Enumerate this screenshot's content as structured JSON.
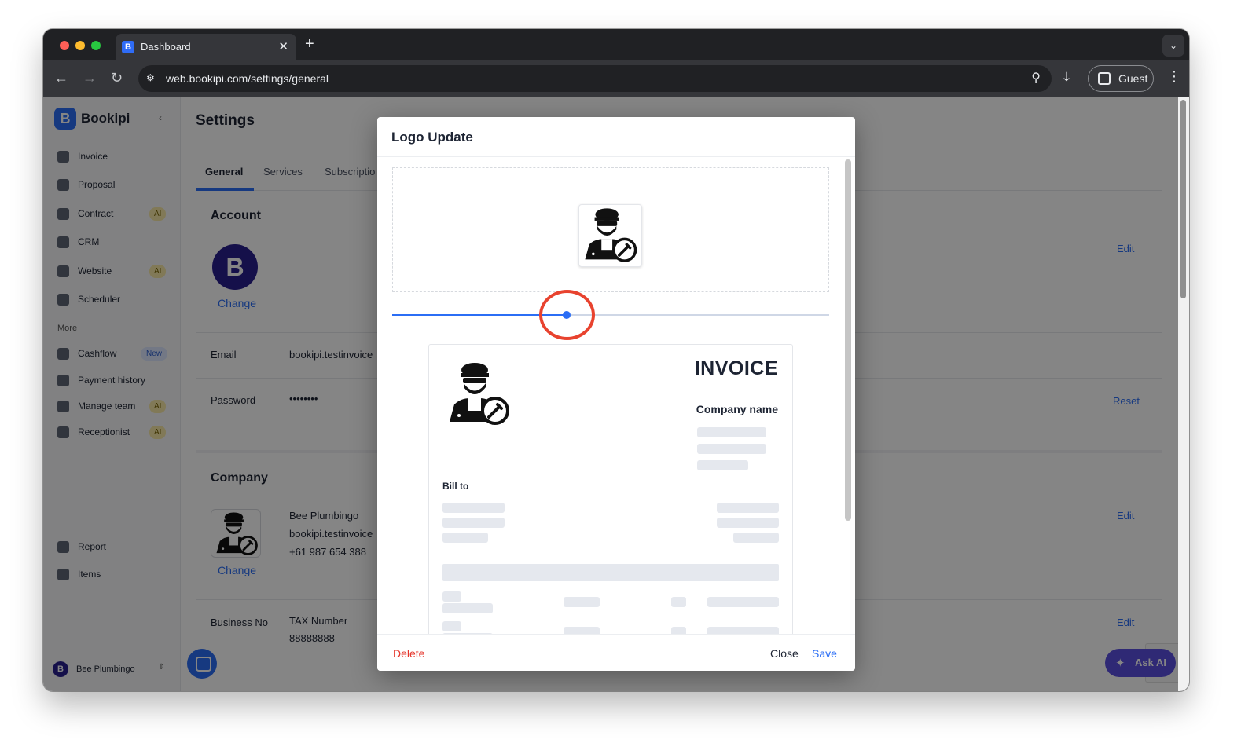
{
  "browser": {
    "tab_title": "Dashboard",
    "tab_favicon_letter": "B",
    "url": "web.bookipi.com/settings/general",
    "profile_label": "Guest"
  },
  "sidebar": {
    "brand": "Bookipi",
    "items": [
      {
        "label": "Invoice",
        "icon": "invoice-icon"
      },
      {
        "label": "Proposal",
        "icon": "proposal-icon"
      },
      {
        "label": "Contract",
        "icon": "contract-icon",
        "badge": "AI"
      },
      {
        "label": "CRM",
        "icon": "crm-icon"
      },
      {
        "label": "Website",
        "icon": "website-icon",
        "badge": "AI"
      },
      {
        "label": "Scheduler",
        "icon": "scheduler-icon"
      }
    ],
    "more_label": "More",
    "more_items": [
      {
        "label": "Cashflow",
        "icon": "cashflow-icon",
        "badge": "New"
      },
      {
        "label": "Payment history",
        "icon": "payment-history-icon"
      },
      {
        "label": "Manage team",
        "icon": "team-icon",
        "badge": "AI"
      },
      {
        "label": "Receptionist",
        "icon": "headset-icon",
        "badge": "AI"
      }
    ],
    "bottom_items": [
      {
        "label": "Report",
        "icon": "report-icon"
      },
      {
        "label": "Items",
        "icon": "items-icon"
      }
    ],
    "account_name": "Bee Plumbingo"
  },
  "settings": {
    "title": "Settings",
    "tabs": [
      "General",
      "Services",
      "Subscriptio"
    ],
    "account": {
      "heading": "Account",
      "avatar_letter": "B",
      "change_label": "Change",
      "edit_label": "Edit",
      "email_label": "Email",
      "email_value": "bookipi.testinvoice",
      "password_label": "Password",
      "password_value": "••••••••",
      "reset_label": "Reset"
    },
    "company": {
      "heading": "Company",
      "change_label": "Change",
      "name": "Bee Plumbingo",
      "email": "bookipi.testinvoice",
      "phone": "+61 987 654 388",
      "edit_label": "Edit",
      "business_no_label": "Business No",
      "tax_label": "TAX Number",
      "tax_value": "88888888",
      "business_edit_label": "Edit"
    },
    "ask_ai_label": "Ask AI"
  },
  "modal": {
    "title": "Logo Update",
    "zoom_slider_value_pct": 40,
    "preview": {
      "title": "INVOICE",
      "company_name": "Company name",
      "bill_to": "Bill to"
    },
    "delete_label": "Delete",
    "close_label": "Close",
    "save_label": "Save"
  },
  "colors": {
    "accent": "#2b6ef5",
    "danger": "#e5352b",
    "highlight_ring": "#e8432f",
    "brand_dark": "#2a1f8f"
  }
}
